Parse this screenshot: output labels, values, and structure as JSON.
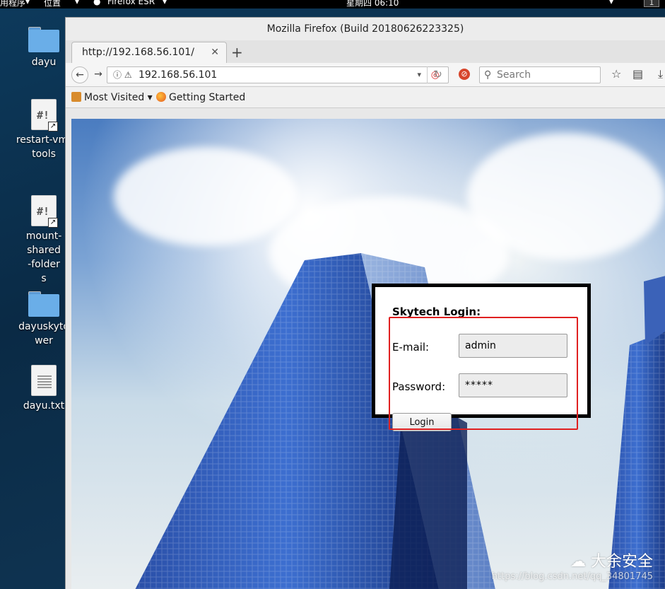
{
  "system_bar": {
    "apps_menu": "用程序",
    "places_menu": "位置",
    "active_app": "Firefox ESR",
    "clock": "星期四 06:10",
    "workspace": "1"
  },
  "desktop": {
    "icons": [
      {
        "label": "dayu",
        "kind": "folder"
      },
      {
        "label": "restart-vm-tools",
        "kind": "script"
      },
      {
        "label": "mount-shared-folders",
        "kind": "script"
      },
      {
        "label": "dayuskytower",
        "kind": "folder"
      },
      {
        "label": "dayu.txt",
        "kind": "text"
      }
    ]
  },
  "browser": {
    "window_title": "Mozilla Firefox (Build 20180626223325)",
    "tab_title": "http://192.168.56.101/",
    "url": "192.168.56.101",
    "search_placeholder": "Search",
    "bookmarks": [
      "Most Visited",
      "Getting Started"
    ]
  },
  "login": {
    "title": "Skytech Login:",
    "email_label": "E-mail:",
    "email_value": "admin",
    "password_label": "Password:",
    "password_value": "*****",
    "button_label": "Login"
  },
  "watermark": {
    "brand": "大余安全",
    "url": "https://blog.csdn.net/qq_34801745"
  },
  "colors": {
    "highlight_box": "#e02020",
    "login_border": "#000000"
  }
}
